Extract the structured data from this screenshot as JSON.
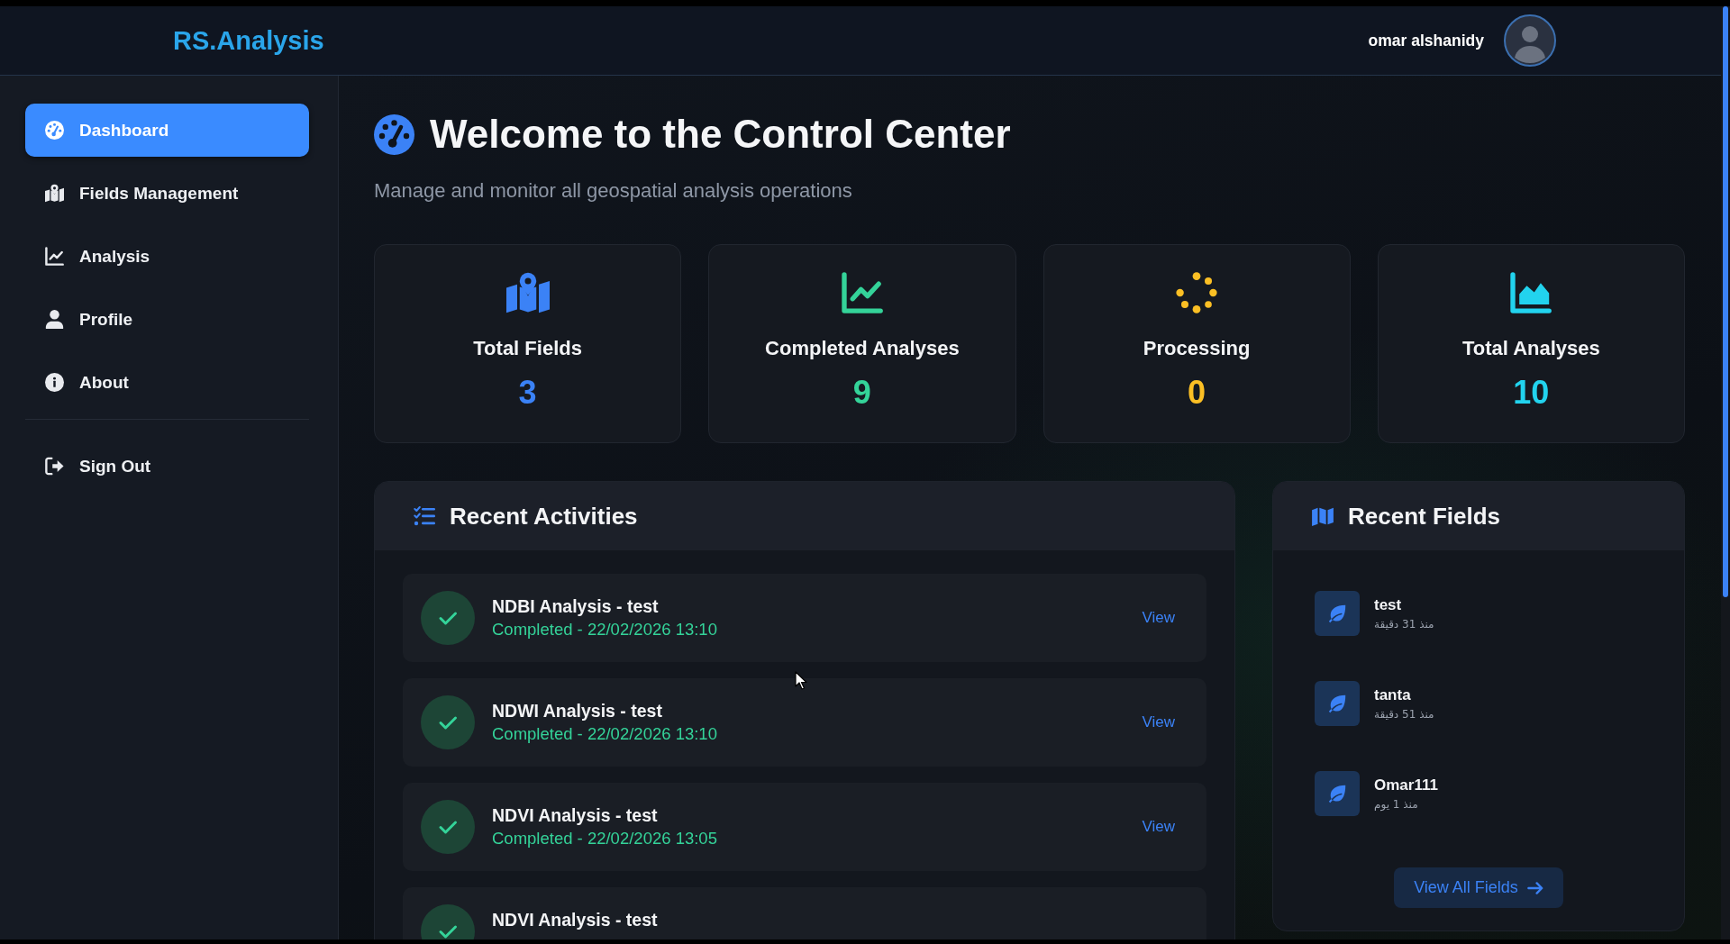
{
  "header": {
    "logo": "RS.Analysis",
    "user_name": "omar alshanidy"
  },
  "sidebar": {
    "items": [
      {
        "label": "Dashboard",
        "selected": true
      },
      {
        "label": "Fields Management",
        "selected": false
      },
      {
        "label": "Analysis",
        "selected": false
      },
      {
        "label": "Profile",
        "selected": false
      },
      {
        "label": "About",
        "selected": false
      }
    ],
    "sign_out": "Sign Out"
  },
  "page": {
    "title": "Welcome to the Control Center",
    "subtitle": "Manage and monitor all geospatial analysis operations"
  },
  "stats": [
    {
      "label": "Total Fields",
      "value": "3",
      "color": "#3b82f6"
    },
    {
      "label": "Completed Analyses",
      "value": "9",
      "color": "#34d399"
    },
    {
      "label": "Processing",
      "value": "0",
      "color": "#fbbf24"
    },
    {
      "label": "Total Analyses",
      "value": "10",
      "color": "#22d3ee"
    }
  ],
  "recent_activities": {
    "title": "Recent Activities",
    "items": [
      {
        "title": "NDBI Analysis - test",
        "status": "Completed - 22/02/2026 13:10",
        "action": "View",
        "completed": true
      },
      {
        "title": "NDWI Analysis - test",
        "status": "Completed - 22/02/2026 13:10",
        "action": "View",
        "completed": true
      },
      {
        "title": "NDVI Analysis - test",
        "status": "Completed - 22/02/2026 13:05",
        "action": "View",
        "completed": true
      },
      {
        "title": "NDVI Analysis - test",
        "completed": true
      }
    ]
  },
  "recent_fields": {
    "title": "Recent Fields",
    "items": [
      {
        "name": "test",
        "time": "منذ 31 دقيقة"
      },
      {
        "name": "tanta",
        "time": "منذ 51 دقيقة"
      },
      {
        "name": "Omar111",
        "time": "منذ 1 يوم"
      }
    ],
    "button": "View All Fields"
  }
}
